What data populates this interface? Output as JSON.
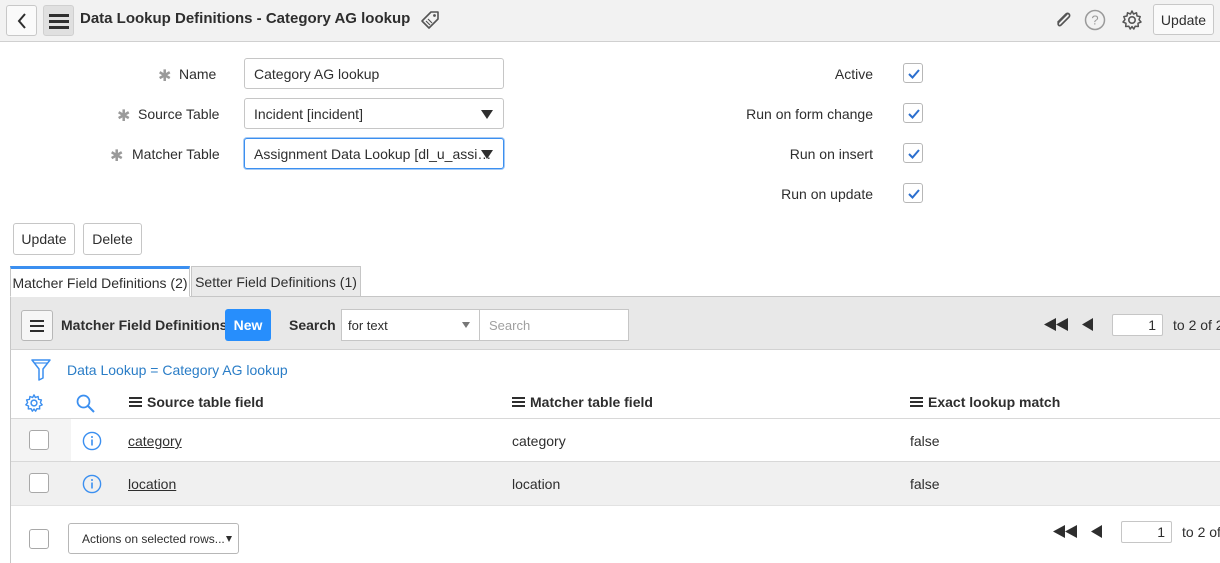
{
  "header": {
    "title": "Data Lookup Definitions - Category AG lookup",
    "update_label": "Update"
  },
  "form": {
    "name_label": "Name",
    "name_value": "Category AG lookup",
    "source_table_label": "Source Table",
    "source_table_value": "Incident [incident]",
    "matcher_table_label": "Matcher Table",
    "matcher_table_value": "Assignment Data Lookup [dl_u_assi…",
    "active_label": "Active",
    "run_on_form_change_label": "Run on form change",
    "run_on_insert_label": "Run on insert",
    "run_on_update_label": "Run on update",
    "active_checked": true,
    "run_on_form_change_checked": true,
    "run_on_insert_checked": true,
    "run_on_update_checked": true,
    "update_button": "Update",
    "delete_button": "Delete"
  },
  "tabs": [
    {
      "label": "Matcher Field Definitions (2)",
      "active": true
    },
    {
      "label": "Setter Field Definitions (1)",
      "active": false
    }
  ],
  "list": {
    "title": "Matcher Field Definitions",
    "new_label": "New",
    "search_label": "Search",
    "search_field": "for text",
    "search_placeholder": "Search",
    "page_value": "1",
    "page_total_top": "to 2 of 2",
    "page_total_bottom": "to 2 of",
    "filter_text": "Data Lookup = Category AG lookup",
    "columns": [
      "Source table field",
      "Matcher table field",
      "Exact lookup match"
    ],
    "rows": [
      {
        "source": "category",
        "matcher": "category",
        "exact": "false"
      },
      {
        "source": "location",
        "matcher": "location",
        "exact": "false"
      }
    ],
    "actions_label": "Actions on selected rows..."
  },
  "colors": {
    "accent": "#278efc",
    "link": "#2a7dc7",
    "check": "#2b6fcf"
  }
}
